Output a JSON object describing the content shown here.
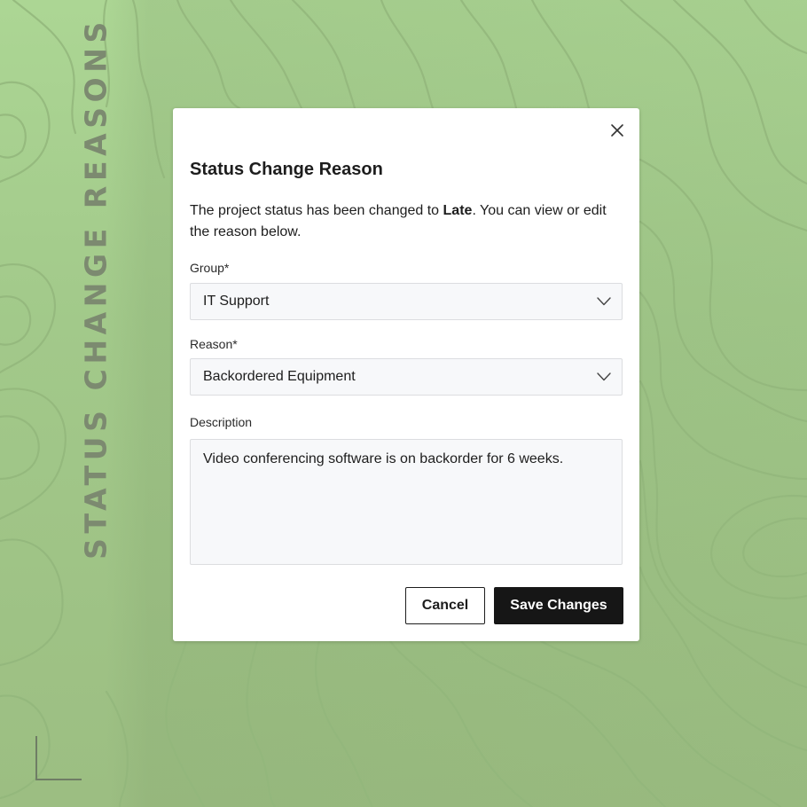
{
  "side_title": "STATUS CHANGE REASONS",
  "modal": {
    "title": "Status Change Reason",
    "intro_prefix": "The project status has been changed to ",
    "intro_status": "Late",
    "intro_suffix": ". You can view or edit the reason below.",
    "group": {
      "label": "Group*",
      "value": "IT Support"
    },
    "reason": {
      "label": "Reason*",
      "value": "Backordered Equipment"
    },
    "description": {
      "label": "Description",
      "value": "Video conferencing software is on backorder for 6 weeks."
    },
    "cancel_label": "Cancel",
    "save_label": "Save Changes"
  },
  "icons": {
    "close": "close-icon",
    "dropdown": "chevron-down-icon"
  },
  "colors": {
    "background": "#a6cc8d",
    "primary_button": "#161616",
    "side_title": "#7c8a70"
  }
}
